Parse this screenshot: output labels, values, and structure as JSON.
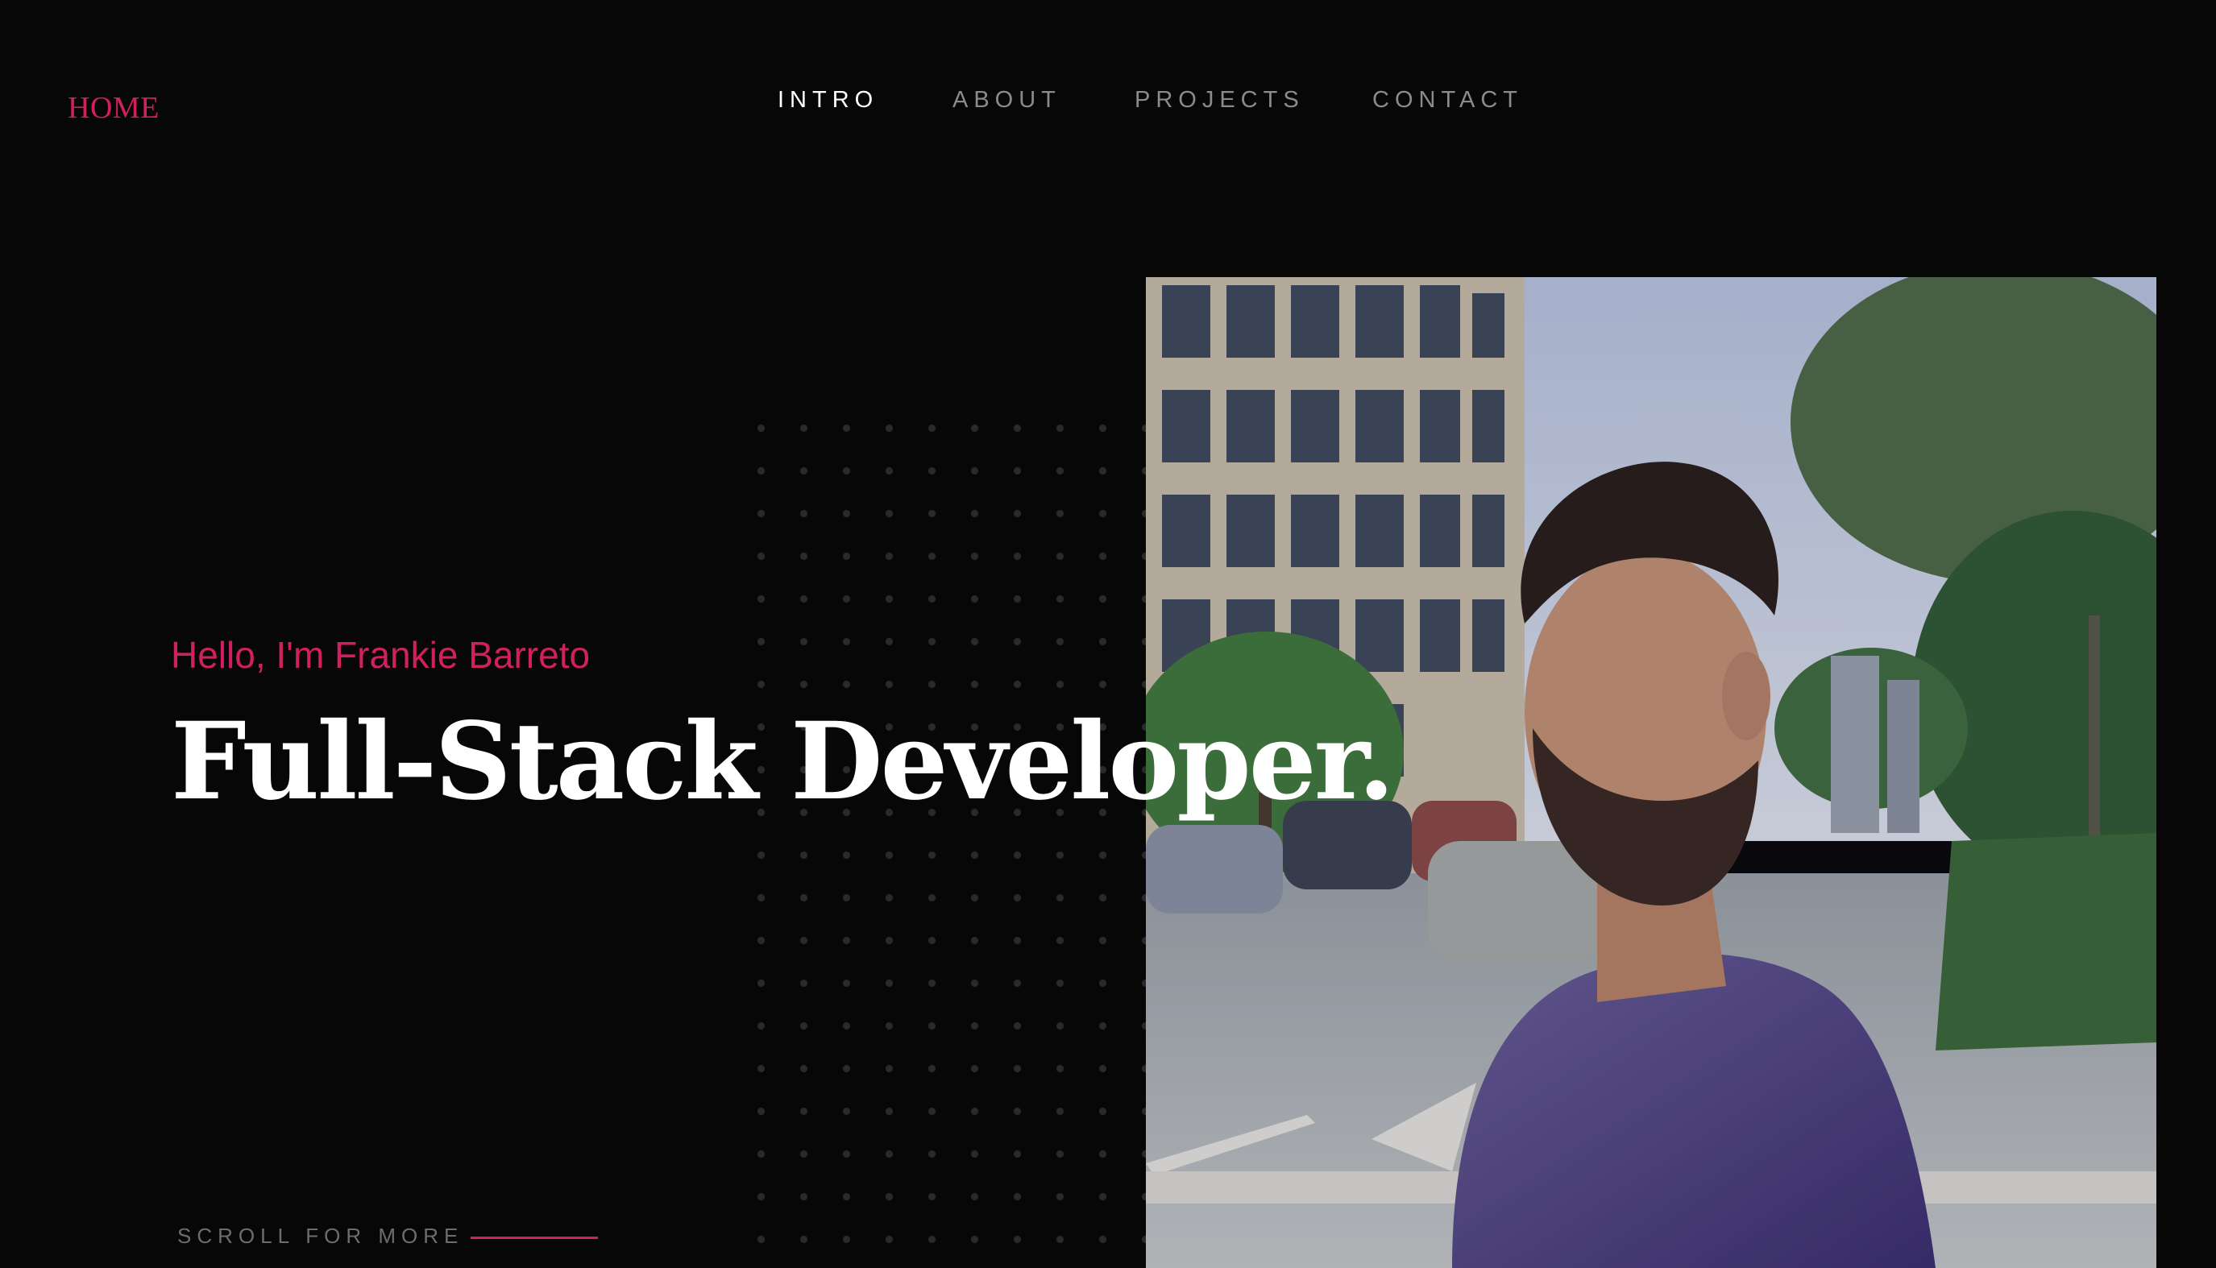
{
  "header": {
    "logo_label": "HOME"
  },
  "nav": {
    "items": [
      {
        "label": "INTRO",
        "active": true
      },
      {
        "label": "ABOUT",
        "active": false
      },
      {
        "label": "PROJECTS",
        "active": false
      },
      {
        "label": "CONTACT",
        "active": false
      }
    ]
  },
  "hero": {
    "greeting": "Hello, I'm Frankie Barreto",
    "headline": "Full-Stack Developer.",
    "scroll_label": "SCROLL FOR MORE",
    "photo_alt": "portrait-photo"
  },
  "colors": {
    "background": "#070708",
    "accent": "#d1205f",
    "nav_active": "#ffffff",
    "nav_inactive": "#8b8b8f"
  }
}
